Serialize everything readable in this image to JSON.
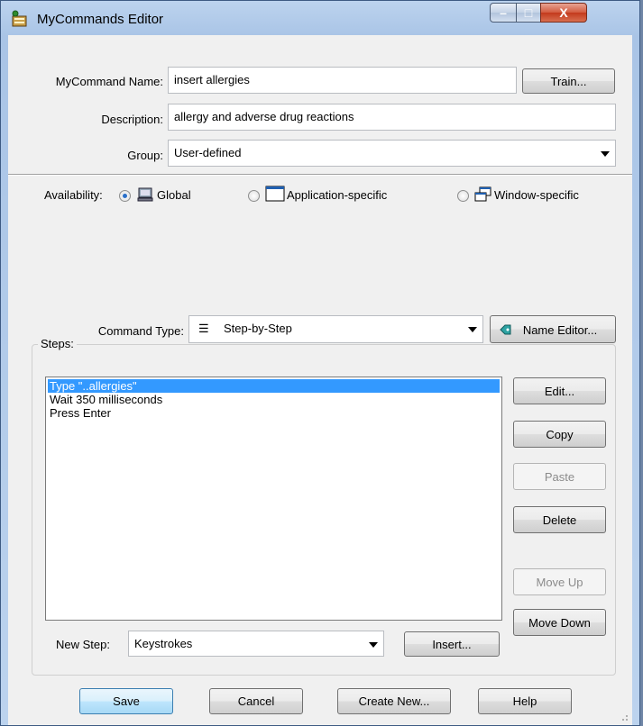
{
  "window": {
    "title": "MyCommands Editor",
    "app_icon": "mycommands-icon",
    "minimize_icon": "minimize-icon",
    "maximize_icon": "maximize-icon",
    "close_icon": "close-icon",
    "minimize_glyph": "–",
    "maximize_glyph": "□",
    "close_glyph": "X"
  },
  "form": {
    "name_label": "MyCommand Name:",
    "name_value": "insert allergies",
    "train_label": "Train...",
    "description_label": "Description:",
    "description_value": "allergy and adverse drug reactions",
    "group_label": "Group:",
    "group_value": "User-defined"
  },
  "availability": {
    "label": "Availability:",
    "options": [
      {
        "label": "Global",
        "selected": true,
        "icon": "computer-icon"
      },
      {
        "label": "Application-specific",
        "selected": false,
        "icon": "application-window-icon"
      },
      {
        "label": "Window-specific",
        "selected": false,
        "icon": "windows-icon"
      }
    ]
  },
  "command_type": {
    "label": "Command Type:",
    "value": "Step-by-Step",
    "value_icon": "list-icon",
    "value_glyph": "☰",
    "name_editor_label": "Name Editor...",
    "name_editor_icon": "tag-icon"
  },
  "steps": {
    "title": "Steps:",
    "items": [
      "Type \"..allergies\"",
      "Wait 350 milliseconds",
      "Press Enter"
    ],
    "selected_index": 0,
    "edit_label": "Edit...",
    "copy_label": "Copy",
    "paste_label": "Paste",
    "delete_label": "Delete",
    "move_up_label": "Move Up",
    "move_down_label": "Move Down",
    "new_step_label": "New Step:",
    "new_step_value": "Keystrokes",
    "insert_label": "Insert..."
  },
  "footer": {
    "save_label": "Save",
    "cancel_label": "Cancel",
    "create_new_label": "Create New...",
    "help_label": "Help"
  },
  "colors": {
    "selection": "#3399ff",
    "close_button": "#c3391c",
    "title_bar": "#a9c4e6"
  }
}
